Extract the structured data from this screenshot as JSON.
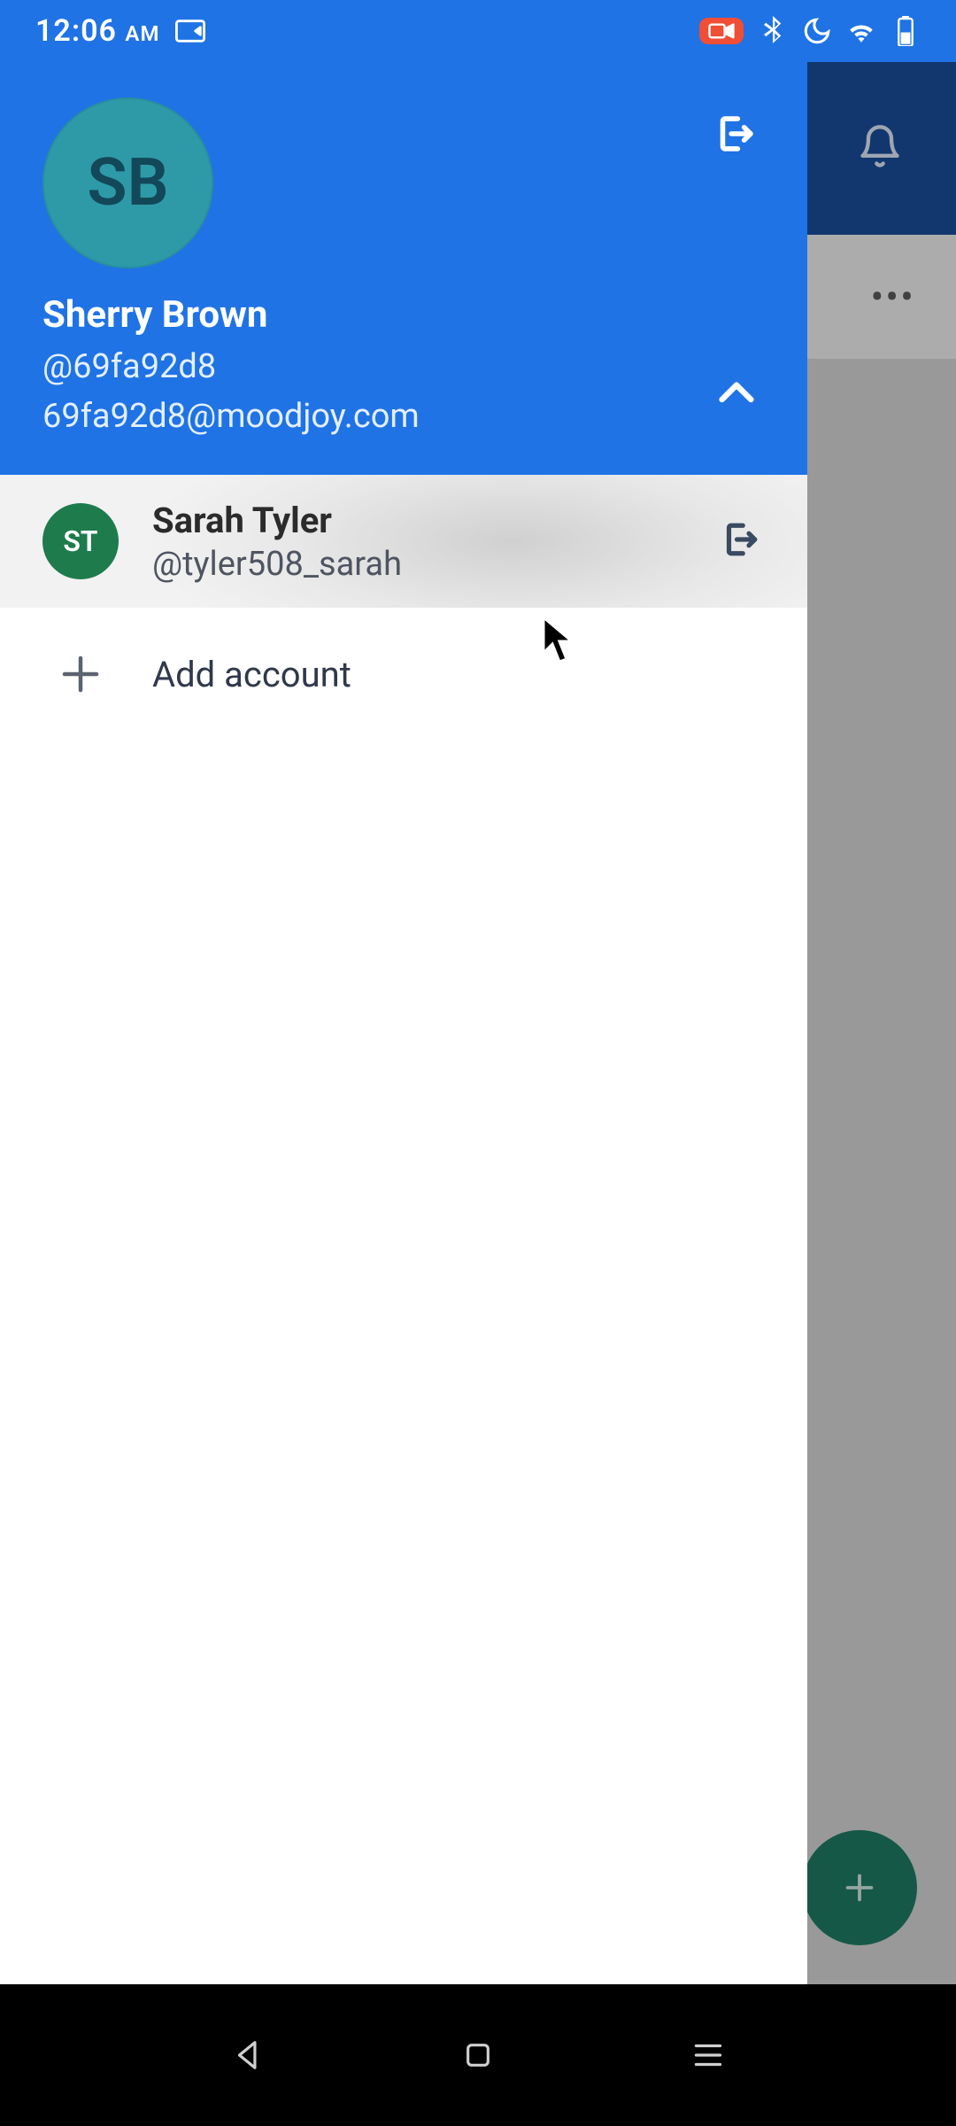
{
  "status": {
    "time": "12:06",
    "ampm": "AM"
  },
  "drawer": {
    "current": {
      "initials": "SB",
      "name": "Sherry Brown",
      "handle": "@69fa92d8",
      "email": "69fa92d8@moodjoy.com"
    },
    "other_accounts": [
      {
        "initials": "ST",
        "name": "Sarah Tyler",
        "handle": "@tyler508_sarah"
      }
    ],
    "add_account_label": "Add account"
  },
  "overflow": {
    "dots": "•••"
  }
}
